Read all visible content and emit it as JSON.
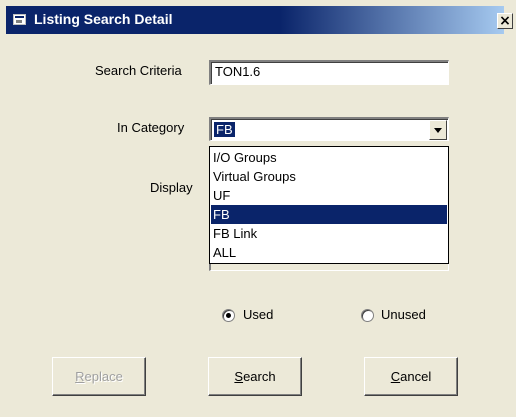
{
  "window": {
    "title": "Listing Search Detail",
    "close_glyph": "×"
  },
  "search_criteria": {
    "label": "Search Criteria",
    "value": "TON1.6"
  },
  "category": {
    "label": "In Category",
    "selected": "FB",
    "options": [
      "I/O Groups",
      "Virtual Groups",
      "UF",
      "FB",
      "FB Link",
      "ALL"
    ],
    "highlighted_index": 3
  },
  "display": {
    "label": "Display"
  },
  "usage": {
    "used_label": "Used",
    "unused_label": "Unused",
    "selected": "Used"
  },
  "buttons": {
    "replace": {
      "mnemonic": "R",
      "rest": "eplace",
      "enabled": false
    },
    "search": {
      "mnemonic": "S",
      "rest": "earch",
      "enabled": true
    },
    "cancel": {
      "mnemonic": "C",
      "rest": "ancel",
      "enabled": true
    }
  },
  "icons": {
    "title_icon": "window-app-icon",
    "close": "close-icon",
    "dropdown": "chevron-down-icon"
  },
  "colors": {
    "titlebar": "#0a246a",
    "dialog_bg": "#ece9d8",
    "selection": "#0a246a"
  }
}
